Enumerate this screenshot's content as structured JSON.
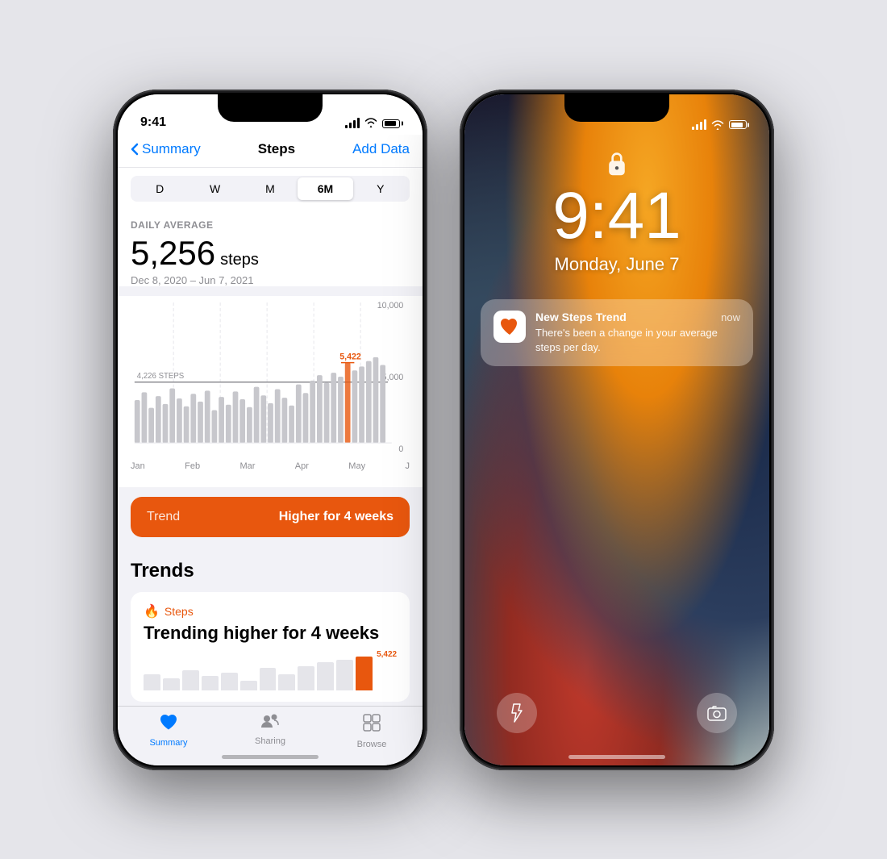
{
  "phone1": {
    "statusBar": {
      "time": "9:41",
      "signal": [
        4,
        7,
        10,
        13
      ],
      "battery": 85
    },
    "nav": {
      "back_label": "Summary",
      "title": "Steps",
      "action_label": "Add Data"
    },
    "timePills": [
      "D",
      "W",
      "M",
      "6M",
      "Y"
    ],
    "activeTimePill": "6M",
    "stats": {
      "daily_label": "DAILY AVERAGE",
      "value": "5,256",
      "unit": "steps",
      "date_range": "Dec 8, 2020 – Jun 7, 2021"
    },
    "chart": {
      "y_max": "10,000",
      "y_mid": "5,000",
      "y_min": "0",
      "highlighted_value": "5,422",
      "baseline_label": "4,226 STEPS",
      "months": [
        "Jan",
        "Feb",
        "Mar",
        "Apr",
        "May",
        "J"
      ]
    },
    "trendButton": {
      "left": "Trend",
      "right": "Higher for 4 weeks"
    },
    "trendsSection": {
      "title": "Trends",
      "card": {
        "category": "Steps",
        "headline": "Trending higher for 4 weeks",
        "highlighted": "5,422"
      }
    },
    "tabBar": [
      {
        "label": "Summary",
        "icon": "♥",
        "active": true
      },
      {
        "label": "Sharing",
        "icon": "👥",
        "active": false
      },
      {
        "label": "Browse",
        "icon": "⊞",
        "active": false
      }
    ]
  },
  "phone2": {
    "statusBar": {
      "time": "",
      "signal": [
        4,
        7,
        10,
        13
      ]
    },
    "lockIcon": "🔓",
    "time": "9:41",
    "date": "Monday, June 7",
    "notification": {
      "app_name": "New Steps Trend",
      "time": "now",
      "message": "There's been a change in your average steps per day."
    },
    "bottomButtons": {
      "left": "flashlight",
      "right": "camera"
    }
  }
}
